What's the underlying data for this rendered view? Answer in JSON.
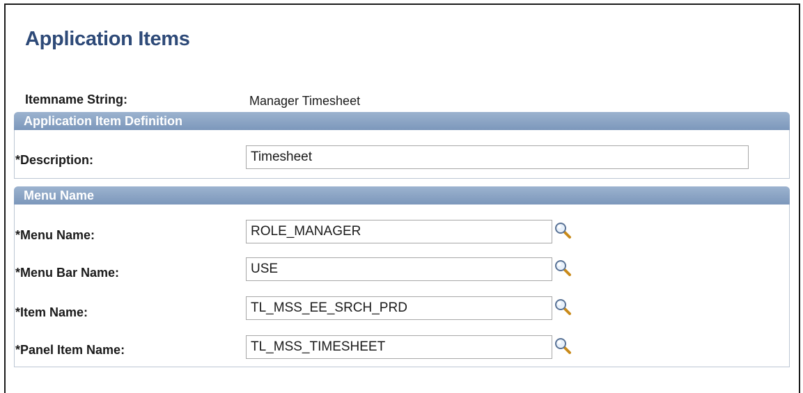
{
  "page": {
    "title": "Application Items"
  },
  "itemname": {
    "label": "Itemname String:",
    "value": "Manager Timesheet"
  },
  "definition": {
    "header": "Application Item Definition",
    "description": {
      "label": "*Description:",
      "value": "Timesheet"
    }
  },
  "menu": {
    "header": "Menu Name",
    "menu_name": {
      "label": "*Menu Name:",
      "value": "ROLE_MANAGER",
      "lookup_icon": "magnifier-icon"
    },
    "menu_bar_name": {
      "label": "*Menu Bar Name:",
      "value": "USE",
      "lookup_icon": "magnifier-icon"
    },
    "item_name": {
      "label": "*Item Name:",
      "value": "TL_MSS_EE_SRCH_PRD",
      "lookup_icon": "magnifier-icon"
    },
    "panel_item_name": {
      "label": "*Panel Item Name:",
      "value": "TL_MSS_TIMESHEET",
      "lookup_icon": "magnifier-icon"
    }
  },
  "colors": {
    "title": "#2e4a78",
    "header_top": "#9cb3cf",
    "header_bottom": "#7c97bb",
    "border": "#bcc6d3"
  }
}
